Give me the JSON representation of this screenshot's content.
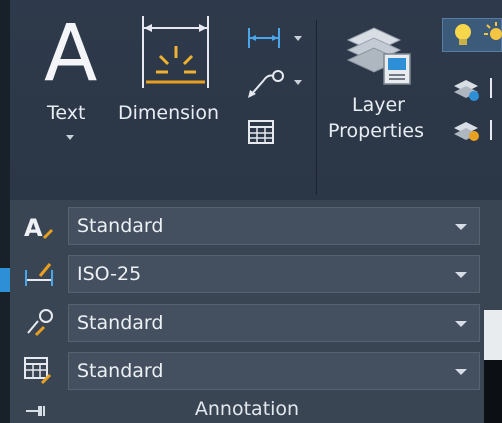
{
  "ribbon": {
    "text_tool": {
      "label": "Text"
    },
    "dimension_tool": {
      "label": "Dimension"
    },
    "layer_properties": {
      "label_line1": "Layer",
      "label_line2": "Properties"
    }
  },
  "annotation_panel": {
    "title": "Annotation",
    "rows": [
      {
        "icon": "text-style-icon",
        "value": "Standard"
      },
      {
        "icon": "dimension-style-icon",
        "value": "ISO-25"
      },
      {
        "icon": "multileader-style-icon",
        "value": "Standard"
      },
      {
        "icon": "table-style-icon",
        "value": "Standard"
      }
    ]
  },
  "colors": {
    "ribbon_bg": "#2e3a4b",
    "panel_bg": "#3a4554",
    "dropdown_bg": "#44505f",
    "accent_blue": "#2e8fd6",
    "accent_orange": "#e8a020",
    "bulb_yellow": "#f6d64a"
  }
}
